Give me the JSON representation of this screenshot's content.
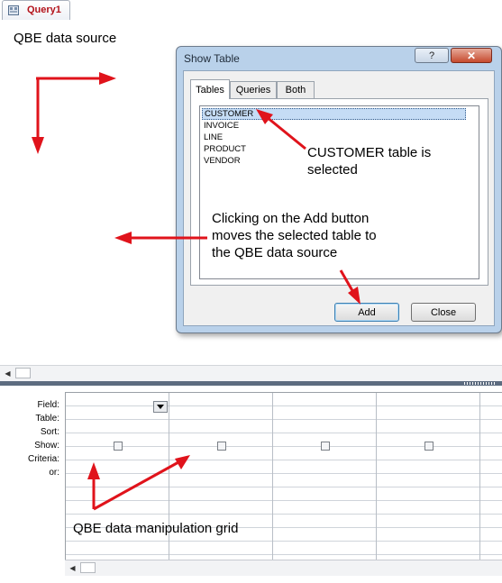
{
  "document_tab": {
    "label": "Query1",
    "icon": "query-icon"
  },
  "source_pane": {
    "title": "QBE data source"
  },
  "dialog": {
    "title": "Show Table",
    "help_label": "?",
    "close_label": "✕",
    "tabs": [
      {
        "label": "Tables",
        "active": true
      },
      {
        "label": "Queries",
        "active": false
      },
      {
        "label": "Both",
        "active": false
      }
    ],
    "tables": [
      "CUSTOMER",
      "INVOICE",
      "LINE",
      "PRODUCT",
      "VENDOR"
    ],
    "selected_table": "CUSTOMER",
    "add_label": "Add",
    "close_button_label": "Close"
  },
  "grid": {
    "row_labels": [
      "Field:",
      "Table:",
      "Sort:",
      "Show:",
      "Criteria:",
      "or:"
    ],
    "columns": 4,
    "show_checked": [
      false,
      false,
      false,
      false
    ]
  },
  "annotations": {
    "customer_selected": "CUSTOMER table is\nselected",
    "add_explanation": "Clicking on the Add button\nmoves the selected table to\nthe QBE data source",
    "grid_label": "QBE data manipulation grid"
  },
  "colors": {
    "annotation_arrow": "#e0131b",
    "dialog_frame": "#b9d1ea",
    "splitter": "#5d6c80",
    "tab_label": "#b3121a"
  }
}
